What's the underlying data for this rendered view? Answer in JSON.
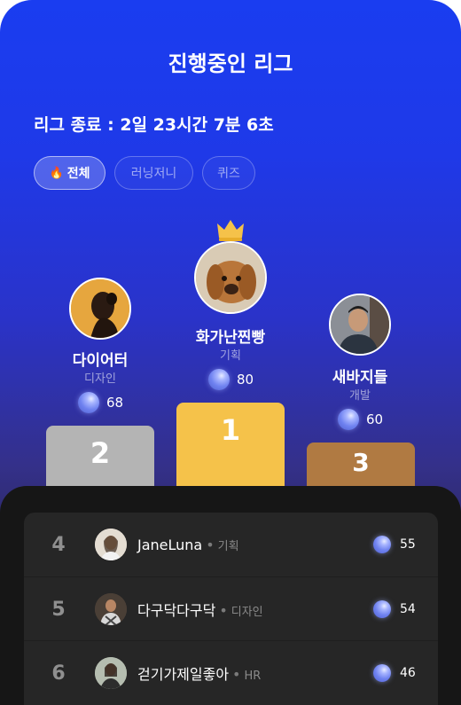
{
  "header": {
    "title": "진행중인 리그"
  },
  "countdown": "리그 종료 : 2일 23시간 7분 6초",
  "tabs": [
    {
      "label": "전체",
      "icon": "fire-icon",
      "active": true
    },
    {
      "label": "러닝저니",
      "active": false
    },
    {
      "label": "퀴즈",
      "active": false
    }
  ],
  "podium": {
    "first": {
      "rank": "1",
      "name": "화가난찐빵",
      "role": "기획",
      "score": "80",
      "color": "#f5c24a"
    },
    "second": {
      "rank": "2",
      "name": "다이어터",
      "role": "디자인",
      "score": "68",
      "color": "#b4b4b4"
    },
    "third": {
      "rank": "3",
      "name": "새바지들",
      "role": "개발",
      "score": "60",
      "color": "#b07a42"
    }
  },
  "ranking": [
    {
      "rank": "4",
      "name": "JaneLuna",
      "dept": "기획",
      "score": "55"
    },
    {
      "rank": "5",
      "name": "다구닥다구닥",
      "dept": "디자인",
      "score": "54"
    },
    {
      "rank": "6",
      "name": "걷기가제일좋아",
      "dept": "HR",
      "score": "46"
    }
  ],
  "colors": {
    "accent": "#1f3cf0",
    "gold": "#f5c24a",
    "silver": "#b4b4b4",
    "bronze": "#b07a42"
  },
  "icons": {
    "crown": "crown-icon",
    "gem": "gem-icon",
    "fire": "fire-icon"
  }
}
